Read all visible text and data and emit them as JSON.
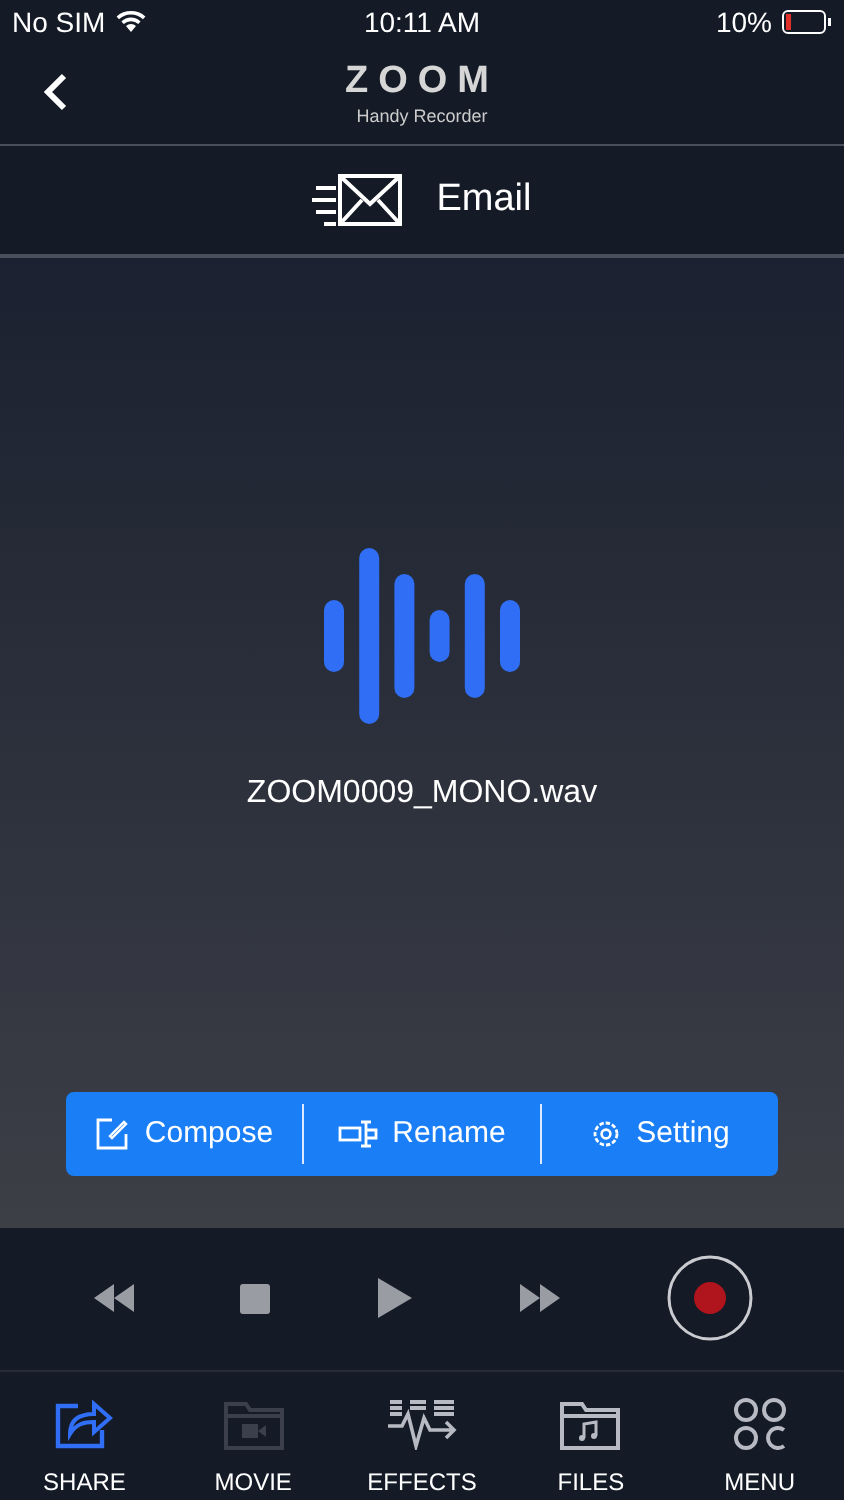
{
  "status_bar": {
    "carrier": "No SIM",
    "time": "10:11 AM",
    "battery": "10%"
  },
  "header": {
    "logo": "ZOOM",
    "subtitle": "Handy Recorder"
  },
  "section": {
    "title": "Email"
  },
  "file": {
    "name": "ZOOM0009_MONO.wav"
  },
  "actions": [
    {
      "kind": "compose",
      "label": "Compose"
    },
    {
      "kind": "rename",
      "label": "Rename"
    },
    {
      "kind": "setting",
      "label": "Setting"
    }
  ],
  "transport": {
    "recording": false
  },
  "tabs": [
    {
      "kind": "share",
      "label": "SHARE",
      "selected": true,
      "disabled": false
    },
    {
      "kind": "movie",
      "label": "MOVIE",
      "selected": false,
      "disabled": true
    },
    {
      "kind": "effects",
      "label": "EFFECTS",
      "selected": false,
      "disabled": false
    },
    {
      "kind": "files",
      "label": "FILES",
      "selected": false,
      "disabled": false
    },
    {
      "kind": "menu",
      "label": "MENU",
      "selected": false,
      "disabled": false
    }
  ]
}
